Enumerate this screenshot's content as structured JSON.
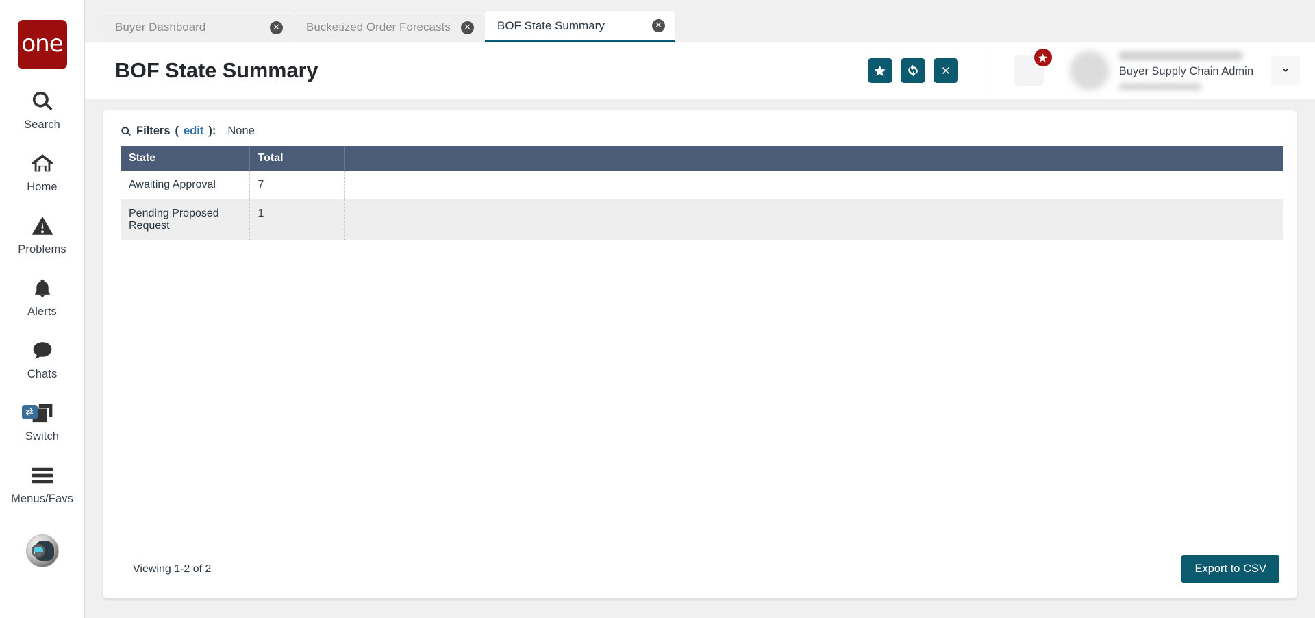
{
  "brand": {
    "logo_text": "one",
    "logo_color": "#9c0d0d"
  },
  "theme": {
    "accent_teal": "#0c5a6e",
    "table_header_blue": "#4a5c78",
    "link_blue": "#2f6fa8",
    "badge_red": "#a71414",
    "switch_badge_blue": "#3b6e96"
  },
  "sidebar": {
    "items": [
      {
        "label": "Search",
        "icon": "search-icon"
      },
      {
        "label": "Home",
        "icon": "home-icon"
      },
      {
        "label": "Problems",
        "icon": "warning-triangle-icon"
      },
      {
        "label": "Alerts",
        "icon": "bell-icon"
      },
      {
        "label": "Chats",
        "icon": "chat-bubble-icon"
      },
      {
        "label": "Switch",
        "icon": "copy-windows-icon",
        "badge_icon": "exchange-arrows-icon"
      },
      {
        "label": "Menus/Favs",
        "icon": "hamburger-icon"
      }
    ],
    "bottom_avatar_icon": "assistant-bot-avatar-icon"
  },
  "tabs": [
    {
      "label": "Buyer Dashboard",
      "active": false,
      "close_icon": "close-circle-icon"
    },
    {
      "label": "Bucketized Order Forecasts",
      "active": false,
      "close_icon": "close-circle-icon"
    },
    {
      "label": "BOF State Summary",
      "active": true,
      "close_icon": "close-circle-icon"
    }
  ],
  "header": {
    "title": "BOF State Summary",
    "actions": [
      {
        "name": "favorite-button",
        "icon": "star-icon"
      },
      {
        "name": "refresh-button",
        "icon": "refresh-icon"
      },
      {
        "name": "close-button",
        "icon": "x-icon"
      }
    ],
    "menu_button_icon": "hamburger-icon",
    "menu_badge_icon": "star-icon",
    "user_role": "Buyer Supply Chain Admin",
    "caret_icon": "chevron-down-icon"
  },
  "filters": {
    "icon": "search-icon",
    "label": "Filters",
    "edit_label": "edit",
    "open_paren": "(",
    "close_paren": "):",
    "value": "None"
  },
  "table": {
    "columns": [
      "State",
      "Total"
    ],
    "rows": [
      {
        "state": "Awaiting Approval",
        "total": "7"
      },
      {
        "state": "Pending Proposed Request",
        "total": "1"
      }
    ]
  },
  "footer": {
    "viewing": "Viewing 1-2 of 2",
    "export_label": "Export to CSV"
  }
}
